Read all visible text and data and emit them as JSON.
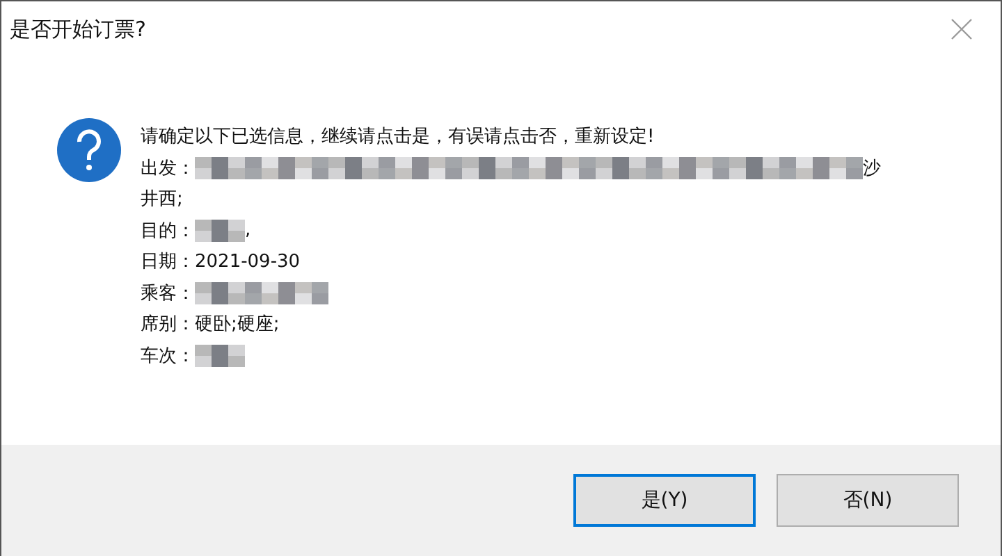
{
  "window": {
    "title": "是否开始订票?"
  },
  "message": {
    "text": "请确定以下已选信息，继续请点击是，有误请点击否，重新设定!",
    "lines": [
      {
        "segments": [
          {
            "kind": "text",
            "text": "出发："
          },
          {
            "kind": "mosaic_long"
          },
          {
            "kind": "text",
            "text": "沙"
          }
        ]
      },
      {
        "segments": [
          {
            "kind": "text",
            "text": "井西;"
          }
        ]
      },
      {
        "segments": [
          {
            "kind": "text",
            "text": "目的："
          },
          {
            "kind": "mosaic_short"
          },
          {
            "kind": "text",
            "text": ","
          }
        ]
      },
      {
        "segments": [
          {
            "kind": "text",
            "text": "日期："
          },
          {
            "kind": "text",
            "text": "2021-09-30"
          }
        ]
      },
      {
        "segments": [
          {
            "kind": "text",
            "text": "乘客："
          },
          {
            "kind": "mosaic_medium"
          }
        ]
      },
      {
        "segments": [
          {
            "kind": "text",
            "text": "席别："
          },
          {
            "kind": "text",
            "text": "硬卧;硬座;"
          }
        ]
      },
      {
        "segments": [
          {
            "kind": "text",
            "text": "车次："
          },
          {
            "kind": "mosaic_short"
          }
        ]
      }
    ]
  },
  "buttons": [
    {
      "label": "是(Y)",
      "focused": true
    },
    {
      "label": "否(N)",
      "focused": false
    }
  ]
}
